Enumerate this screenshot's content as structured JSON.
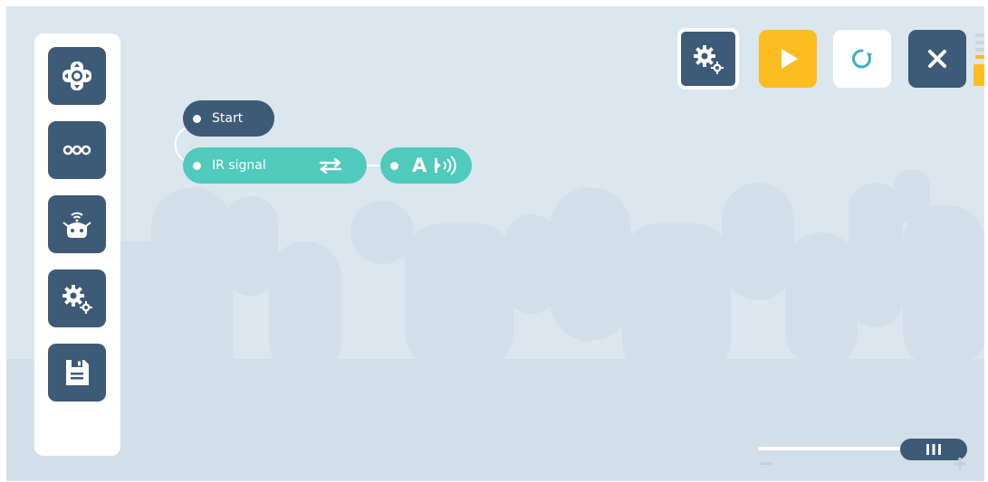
{
  "toolbar": {
    "items": [
      "move-tool",
      "more-options",
      "robot-connection",
      "settings",
      "save"
    ]
  },
  "top_controls": {
    "settings": "settings",
    "run": "play",
    "reset": "reset",
    "close": "close"
  },
  "program": {
    "start_block": {
      "label": "Start"
    },
    "ir_block": {
      "label": "IR signal",
      "icon": "swap-arrows-icon"
    },
    "value_block": {
      "value": "A",
      "icon": "ir-transmit-icon"
    }
  },
  "zoom": {
    "level_fraction": 0.92
  },
  "colors": {
    "background": "#dbe6ee",
    "dark_blue": "#3d5a76",
    "teal": "#4fcabc",
    "yellow": "#fbbd1f"
  }
}
